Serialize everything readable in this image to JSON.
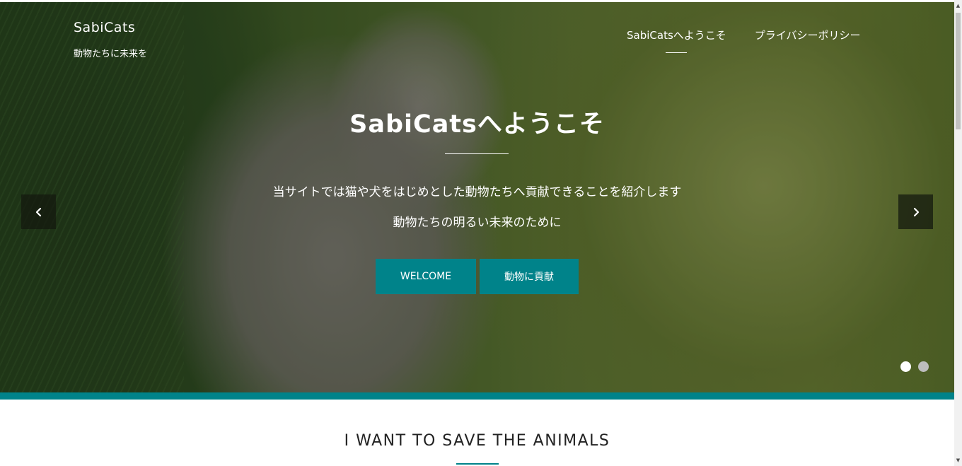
{
  "brand": {
    "name": "SabiCats",
    "tagline": "動物たちに未来を"
  },
  "nav": {
    "items": [
      {
        "label": "SabiCatsへようこそ",
        "active": true
      },
      {
        "label": "プライバシーポリシー",
        "active": false
      }
    ]
  },
  "hero": {
    "title": "SabiCatsへようこそ",
    "line1": "当サイトでは猫や犬をはじめとした動物たちへ貢献できることを紹介します",
    "line2": "動物たちの明るい未来のために",
    "buttons": {
      "welcome": "WELCOME",
      "contribute": "動物に貢献"
    },
    "slides": {
      "count": 2,
      "active_index": 0
    },
    "icons": {
      "prev": "chevron-left-icon",
      "next": "chevron-right-icon"
    }
  },
  "section": {
    "title": "I WANT TO SAVE THE ANIMALS"
  },
  "colors": {
    "accent": "#00838a",
    "text_light": "#ffffff",
    "heading_dark": "#222222"
  }
}
